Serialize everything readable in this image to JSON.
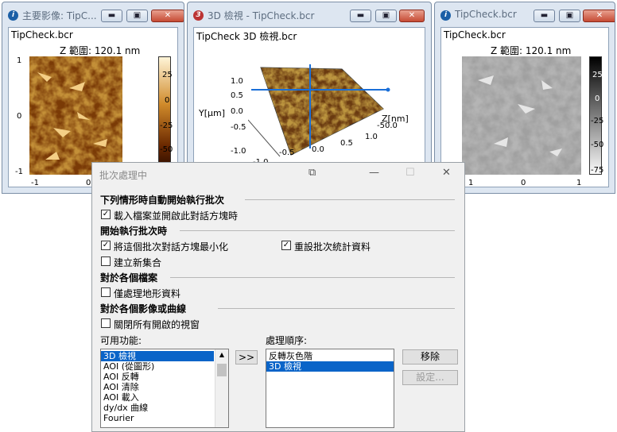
{
  "windows": [
    {
      "title": "主要影像: TipC...",
      "file": "TipCheck.bcr",
      "zrange": "Z 範圍:  120.1 nm",
      "yticks": [
        "1",
        "0",
        "-1"
      ],
      "xticks": [
        "-1",
        "0"
      ],
      "cticks": [
        "25",
        "0",
        "-25",
        "-50"
      ]
    },
    {
      "title": "3D 檢視 - TipCheck.bcr",
      "file": "TipCheck 3D 檢視.bcr",
      "yticks": [
        "1.0",
        "0.5",
        "0.0",
        "-0.5",
        "-1.0"
      ],
      "ylabel": "Y[µm]",
      "xticks": [
        "-0.5",
        "0.0",
        "0.5",
        "1.0"
      ],
      "ztick": "-50.0",
      "zlabel": "Z[nm]",
      "extra_ticks": [
        "-1.0",
        "-1.0"
      ]
    },
    {
      "title": "TipCheck.bcr",
      "file": "TipCheck.bcr",
      "zrange": "Z 範圍:  120.1 nm",
      "xticks": [
        "1",
        "0",
        "1"
      ],
      "cticks": [
        "25",
        "0",
        "-25",
        "-50",
        "-75"
      ]
    }
  ],
  "colors": {
    "afm_dark": "#3a1600",
    "afm_light": "#f2c26a",
    "accent": "#0a64c8"
  },
  "dialog": {
    "title": "批次處理中",
    "sections": {
      "auto_start": "下列情形時自動開始執行批次",
      "on_start": "開始執行批次時",
      "each_file": "對於各個檔案",
      "each_image": "對於各個影像或曲線"
    },
    "checks": {
      "open_on_load": {
        "label": "載入檔案並開啟此對話方塊時",
        "checked": true
      },
      "minimize": {
        "label": "將這個批次對話方塊最小化",
        "checked": true
      },
      "reset_stats": {
        "label": "重設批次統計資料",
        "checked": true
      },
      "new_set": {
        "label": "建立新集合",
        "checked": false
      },
      "topo_only": {
        "label": "僅處理地形資料",
        "checked": false
      },
      "close_windows": {
        "label": "關閉所有開啟的視窗",
        "checked": false
      }
    },
    "available_label": "可用功能:",
    "order_label": "處理順序:",
    "available": [
      "3D 檢視",
      "AOI (從圖形)",
      "AOI 反轉",
      "AOI 清除",
      "AOI 載入",
      "dy/dx 曲線",
      "Fourier"
    ],
    "available_selected": 0,
    "order": [
      "反轉灰色階",
      "3D 檢視"
    ],
    "order_selected": 1,
    "add_button": ">>",
    "remove_button": "移除",
    "settings_button": "設定..."
  }
}
